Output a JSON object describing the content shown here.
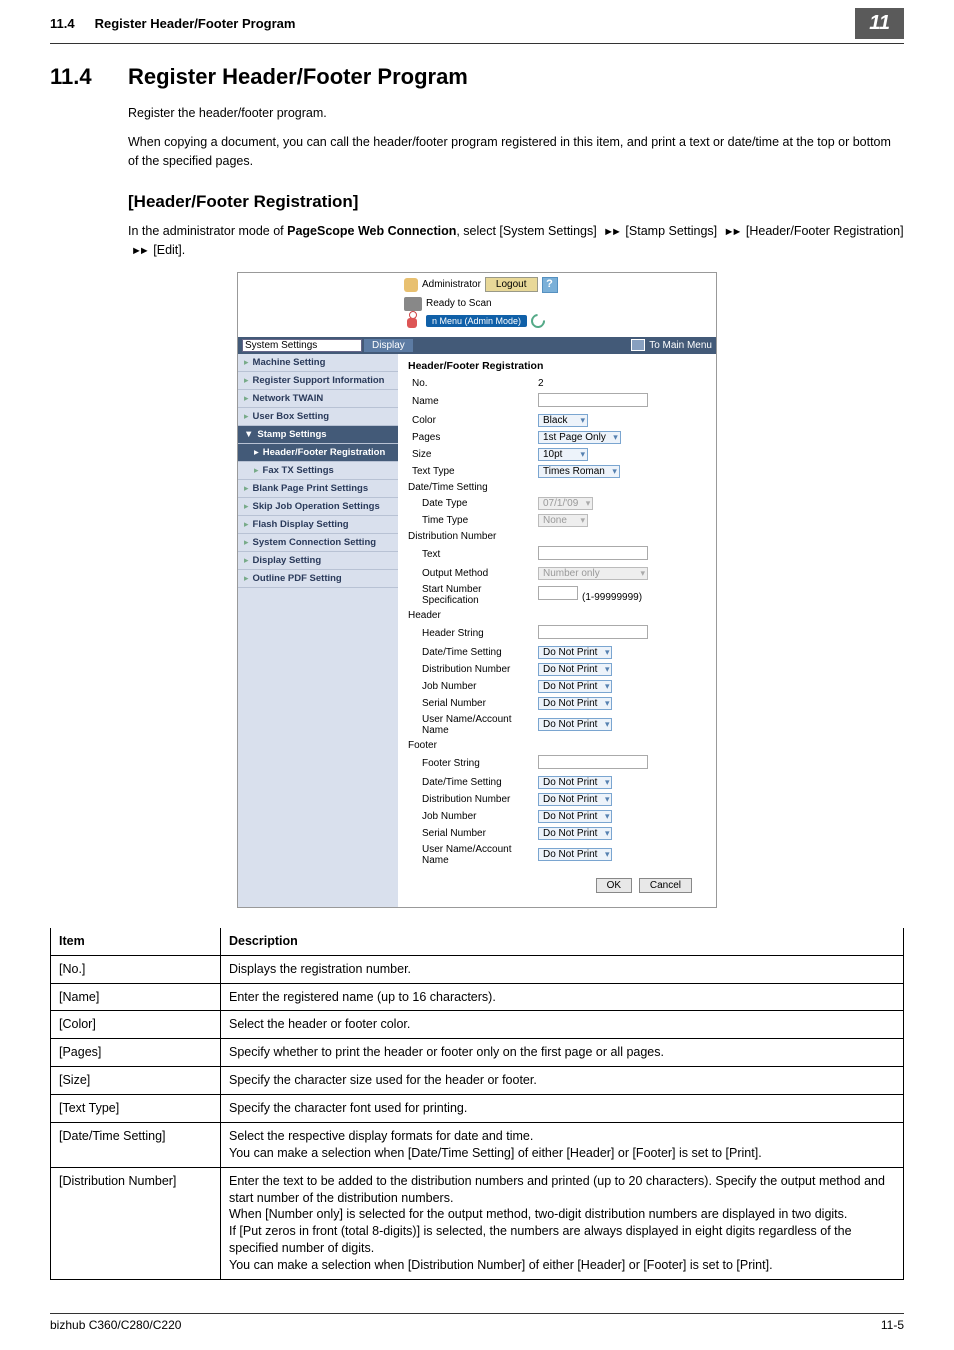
{
  "header": {
    "section_num": "11.4",
    "section_title": "Register Header/Footer Program",
    "chapter": "11"
  },
  "title": {
    "num": "11.4",
    "text": "Register Header/Footer Program"
  },
  "intro_1": "Register the header/footer program.",
  "intro_2": "When copying a document, you can call the header/footer program registered in this item, and print a text or date/time at the top or bottom of the specified pages.",
  "section_heading": "[Header/Footer Registration]",
  "section_desc_pre": "In the administrator mode of ",
  "section_desc_app": "PageScope Web Connection",
  "section_desc_mid1": ", select [System Settings] ",
  "section_desc_mid2": " [Stamp Settings] ",
  "section_desc_end": " [Header/Footer Registration] ",
  "section_desc_last": " [Edit].",
  "screenshot": {
    "admin_label": "Administrator",
    "logout": "Logout",
    "help": "?",
    "ready": "Ready to Scan",
    "menu_mode": "n Menu (Admin Mode)",
    "nav_select": "System Settings",
    "nav_display": "Display",
    "to_main_menu": "To Main Menu",
    "sidebar": [
      "Machine Setting",
      "Register Support Information",
      "Network TWAIN",
      "User Box Setting",
      "Stamp Settings",
      "Header/Footer Registration",
      "Fax TX Settings",
      "Blank Page Print Settings",
      "Skip Job Operation Settings",
      "Flash Display Setting",
      "System Connection Setting",
      "Display Setting",
      "Outline PDF Setting"
    ],
    "panel_heading": "Header/Footer Registration",
    "rows": {
      "no_label": "No.",
      "no_val": "2",
      "name_label": "Name",
      "color_label": "Color",
      "color_val": "Black",
      "pages_label": "Pages",
      "pages_val": "1st Page Only",
      "size_label": "Size",
      "size_val": "10pt",
      "text_type_label": "Text Type",
      "text_type_val": "Times Roman",
      "dts_label": "Date/Time Setting",
      "date_type_label": "Date Type",
      "date_type_val": "07/1/'09",
      "time_type_label": "Time Type",
      "time_type_val": "None",
      "distnum_label": "Distribution Number",
      "text_label": "Text",
      "output_method_label": "Output Method",
      "output_method_val": "Number only",
      "start_num_label": "Start Number Specification",
      "start_num_range": "(1-99999999)",
      "header_label": "Header",
      "header_string_label": "Header String",
      "h_dts": "Date/Time Setting",
      "h_dn": "Distribution Number",
      "h_jn": "Job Number",
      "h_sn": "Serial Number",
      "h_un": "User Name/Account Name",
      "footer_label": "Footer",
      "footer_string_label": "Footer String",
      "dnp": "Do Not Print"
    },
    "ok": "OK",
    "cancel": "Cancel"
  },
  "table": {
    "head_item": "Item",
    "head_desc": "Description",
    "rows": [
      {
        "item": "[No.]",
        "desc": "Displays the registration number."
      },
      {
        "item": "[Name]",
        "desc": "Enter the registered name (up to 16 characters)."
      },
      {
        "item": "[Color]",
        "desc": "Select the header or footer color."
      },
      {
        "item": "[Pages]",
        "desc": "Specify whether to print the header or footer only on the first page or all pages."
      },
      {
        "item": "[Size]",
        "desc": "Specify the character size used for the header or footer."
      },
      {
        "item": "[Text Type]",
        "desc": "Specify the character font used for printing."
      },
      {
        "item": "[Date/Time Setting]",
        "desc": "Select the respective display formats for date and time.\nYou can make a selection when [Date/Time Setting] of either [Header] or [Footer] is set to [Print]."
      },
      {
        "item": "[Distribution Number]",
        "desc": "Enter the text to be added to the distribution numbers and printed (up to 20 characters). Specify the output method and start number of the distribution numbers.\nWhen [Number only] is selected for the output method, two-digit distribution numbers are displayed in two digits.\nIf [Put zeros in front (total 8-digits)] is selected, the numbers are always displayed in eight digits regardless of the specified number of digits.\nYou can make a selection when [Distribution Number] of either [Header] or [Footer] is set to [Print]."
      }
    ]
  },
  "footer": {
    "left": "bizhub C360/C280/C220",
    "right": "11-5"
  }
}
